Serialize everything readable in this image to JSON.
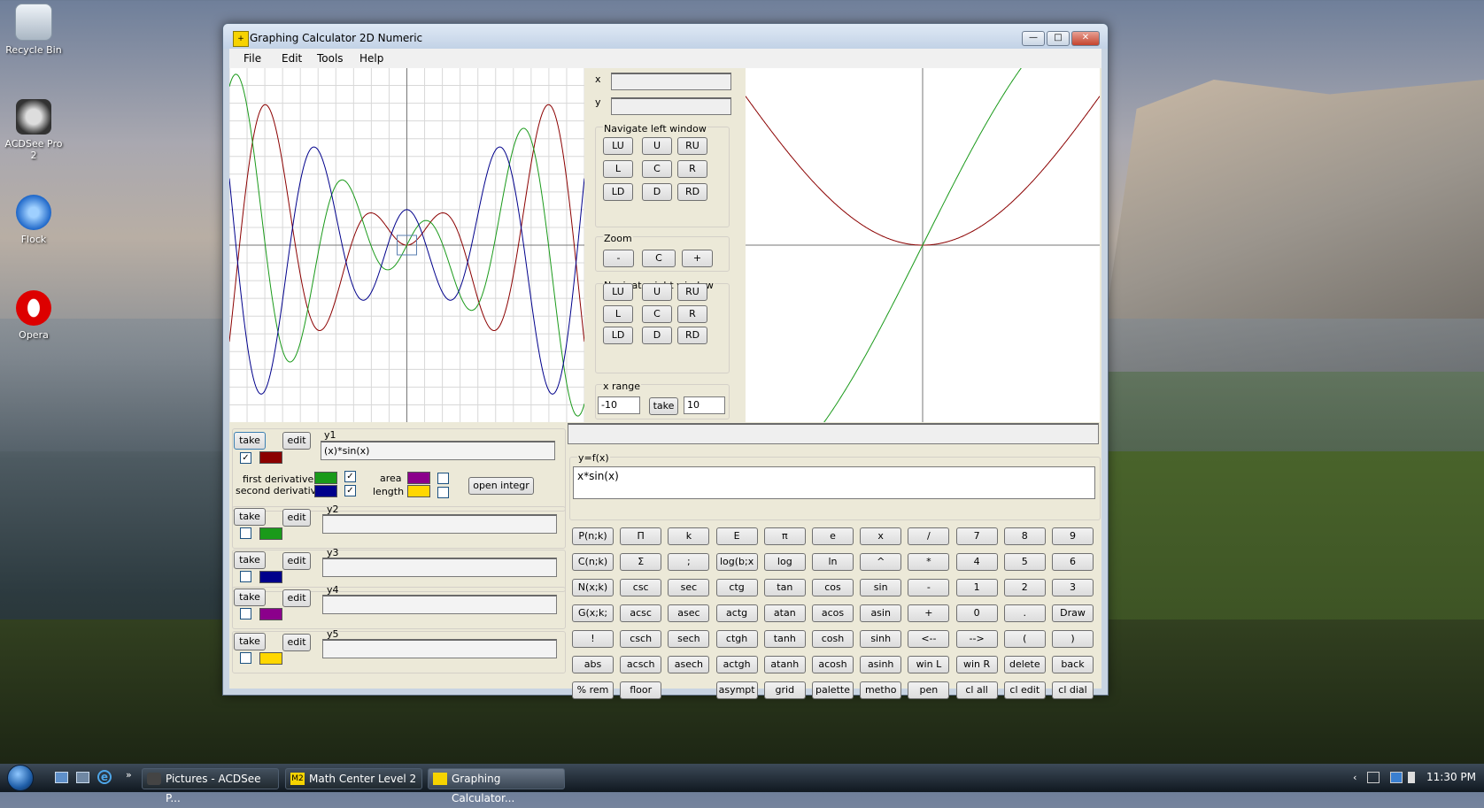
{
  "desktop": {
    "icons": [
      {
        "label": "Recycle Bin"
      },
      {
        "label": "ACDSee Pro 2"
      },
      {
        "label": "Flock"
      },
      {
        "label": "Opera"
      }
    ]
  },
  "window": {
    "title": "Graphing Calculator 2D Numeric",
    "controls": {
      "minimize": "—",
      "maximize": "□",
      "close": "✕"
    },
    "menu": [
      "File",
      "Edit",
      "Tools",
      "Help"
    ]
  },
  "coords": {
    "x_label": "x",
    "y_label": "y",
    "x_value": "",
    "y_value": ""
  },
  "navigate_left": {
    "title": "Navigate left window",
    "buttons": [
      "LU",
      "U",
      "RU",
      "L",
      "C",
      "R",
      "LD",
      "D",
      "RD"
    ]
  },
  "zoom": {
    "title": "Zoom",
    "buttons": [
      "-",
      "C",
      "+"
    ]
  },
  "navigate_right": {
    "title": "Navigate right window",
    "buttons": [
      "LU",
      "U",
      "RU",
      "L",
      "C",
      "R",
      "LD",
      "D",
      "RD"
    ]
  },
  "x_range": {
    "title": "x range",
    "min": "-10",
    "take_label": "take",
    "max": "10"
  },
  "functions": [
    {
      "label": "y1",
      "value": "(x)*sin(x)",
      "take": "take",
      "edit": "edit",
      "checked": true,
      "color": "#8b0000"
    },
    {
      "label": "y2",
      "value": "",
      "take": "take",
      "edit": "edit",
      "checked": false,
      "color": "#1a9a1a"
    },
    {
      "label": "y3",
      "value": "",
      "take": "take",
      "edit": "edit",
      "checked": false,
      "color": "#00008b"
    },
    {
      "label": "y4",
      "value": "",
      "take": "take",
      "edit": "edit",
      "checked": false,
      "color": "#8b008b"
    },
    {
      "label": "y5",
      "value": "",
      "take": "take",
      "edit": "edit",
      "checked": false,
      "color": "#ffd700"
    }
  ],
  "derivatives": {
    "first_label": "first derivative",
    "first_color": "#1a9a1a",
    "first_checked": true,
    "second_label": "second derivative",
    "second_color": "#00008b",
    "second_checked": true,
    "area_label": "area",
    "area_color": "#8b008b",
    "area_checked": false,
    "length_label": "length",
    "length_color": "#ffd700",
    "length_checked": false,
    "open_integr_label": "open integr"
  },
  "status_text": "",
  "expression": {
    "title": "y=f(x)",
    "value": "x*sin(x)"
  },
  "keypad": [
    [
      "P(n;k)",
      "Π",
      "k",
      "E",
      "π",
      "e",
      "x",
      "/",
      "7",
      "8",
      "9"
    ],
    [
      "C(n;k)",
      "Σ",
      ";",
      "log(b;x",
      "log",
      "ln",
      "^",
      "*",
      "4",
      "5",
      "6"
    ],
    [
      "N(x;k)",
      "csc",
      "sec",
      "ctg",
      "tan",
      "cos",
      "sin",
      "-",
      "1",
      "2",
      "3"
    ],
    [
      "G(x;k;",
      "acsc",
      "asec",
      "actg",
      "atan",
      "acos",
      "asin",
      "+",
      "0",
      ".",
      "Draw"
    ],
    [
      "!",
      "csch",
      "sech",
      "ctgh",
      "tanh",
      "cosh",
      "sinh",
      "<--",
      "-->",
      "(",
      ")"
    ],
    [
      "abs",
      "acsch",
      "asech",
      "actgh",
      "atanh",
      "acosh",
      "asinh",
      "win L",
      "win R",
      "delete",
      "back"
    ],
    [
      "% rem",
      "floor",
      "",
      "asympt",
      "grid",
      "palette",
      "metho",
      "pen",
      "cl all",
      "cl edit",
      "cl dial"
    ]
  ],
  "taskbar": {
    "tasks": [
      {
        "label": "Pictures - ACDSee P...",
        "active": false
      },
      {
        "label": "Math Center Level 2",
        "active": false
      },
      {
        "label": "Graphing Calculator...",
        "active": true
      }
    ],
    "clock": "11:30 PM"
  },
  "colors": {
    "y1": "#8b0000",
    "first_derivative": "#1a9a1a",
    "second_derivative": "#00008b"
  }
}
